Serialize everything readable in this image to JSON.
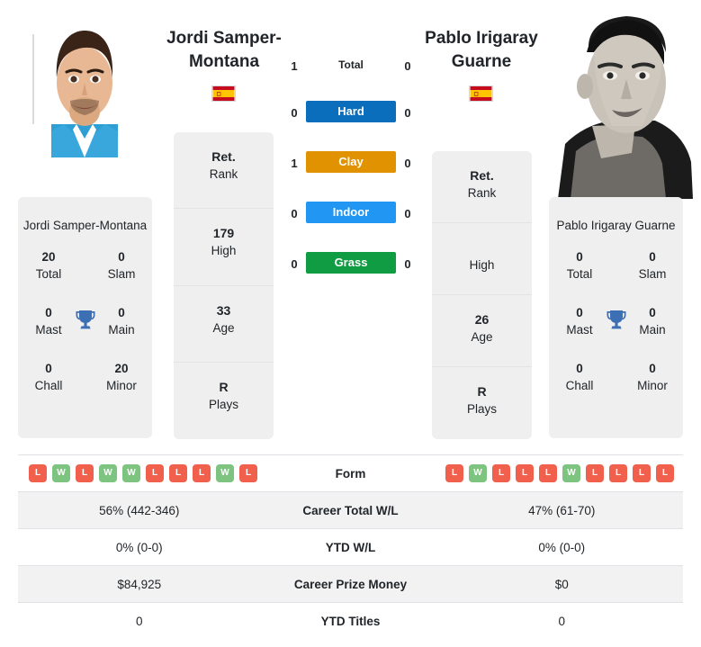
{
  "players": {
    "left": {
      "name": "Jordi Samper-Montana",
      "flag": "spain-flag",
      "card_name": "Jordi Samper-Montana",
      "rank": {
        "value": "Ret.",
        "label": "Rank"
      },
      "high": {
        "value": "179",
        "label": "High"
      },
      "age": {
        "value": "33",
        "label": "Age"
      },
      "plays": {
        "value": "R",
        "label": "Plays"
      },
      "titles": {
        "total": {
          "value": "20",
          "label": "Total"
        },
        "slam": {
          "value": "0",
          "label": "Slam"
        },
        "mast": {
          "value": "0",
          "label": "Mast"
        },
        "main": {
          "value": "0",
          "label": "Main"
        },
        "chall": {
          "value": "0",
          "label": "Chall"
        },
        "minor": {
          "value": "20",
          "label": "Minor"
        }
      },
      "form": [
        "L",
        "W",
        "L",
        "W",
        "W",
        "L",
        "L",
        "L",
        "W",
        "L"
      ],
      "career_total_wl": "56% (442-346)",
      "ytd_wl": "0% (0-0)",
      "career_prize_money": "$84,925",
      "ytd_titles": "0"
    },
    "right": {
      "name": "Pablo Irigaray Guarne",
      "flag": "spain-flag",
      "card_name": "Pablo Irigaray Guarne",
      "rank": {
        "value": "Ret.",
        "label": "Rank"
      },
      "high": {
        "value": "",
        "label": "High"
      },
      "age": {
        "value": "26",
        "label": "Age"
      },
      "plays": {
        "value": "R",
        "label": "Plays"
      },
      "titles": {
        "total": {
          "value": "0",
          "label": "Total"
        },
        "slam": {
          "value": "0",
          "label": "Slam"
        },
        "mast": {
          "value": "0",
          "label": "Mast"
        },
        "main": {
          "value": "0",
          "label": "Main"
        },
        "chall": {
          "value": "0",
          "label": "Chall"
        },
        "minor": {
          "value": "0",
          "label": "Minor"
        }
      },
      "form": [
        "L",
        "W",
        "L",
        "L",
        "L",
        "W",
        "L",
        "L",
        "L",
        "L"
      ],
      "career_total_wl": "47% (61-70)",
      "ytd_wl": "0% (0-0)",
      "career_prize_money": "$0",
      "ytd_titles": "0"
    }
  },
  "h2h": {
    "rows": [
      {
        "label": "Total",
        "left": "1",
        "right": "0",
        "color": "",
        "pill": false
      },
      {
        "label": "Hard",
        "left": "0",
        "right": "0",
        "color": "#0a6ebd",
        "pill": true
      },
      {
        "label": "Clay",
        "left": "1",
        "right": "0",
        "color": "#e09200",
        "pill": true
      },
      {
        "label": "Indoor",
        "left": "0",
        "right": "0",
        "color": "#2196f3",
        "pill": true
      },
      {
        "label": "Grass",
        "left": "0",
        "right": "0",
        "color": "#109c43",
        "pill": true
      }
    ]
  },
  "comparison": {
    "rows": [
      {
        "label": "Form",
        "type": "form"
      },
      {
        "label": "Career Total W/L",
        "type": "text",
        "key": "career_total_wl"
      },
      {
        "label": "YTD W/L",
        "type": "text",
        "key": "ytd_wl"
      },
      {
        "label": "Career Prize Money",
        "type": "text",
        "key": "career_prize_money"
      },
      {
        "label": "YTD Titles",
        "type": "text",
        "key": "ytd_titles"
      }
    ]
  },
  "colors": {
    "badge_win": "#7cc47f",
    "badge_loss": "#f0604d",
    "card_bg": "#efefef",
    "row_shaded": "#f2f2f2",
    "trophy": "#3d6fb4"
  }
}
